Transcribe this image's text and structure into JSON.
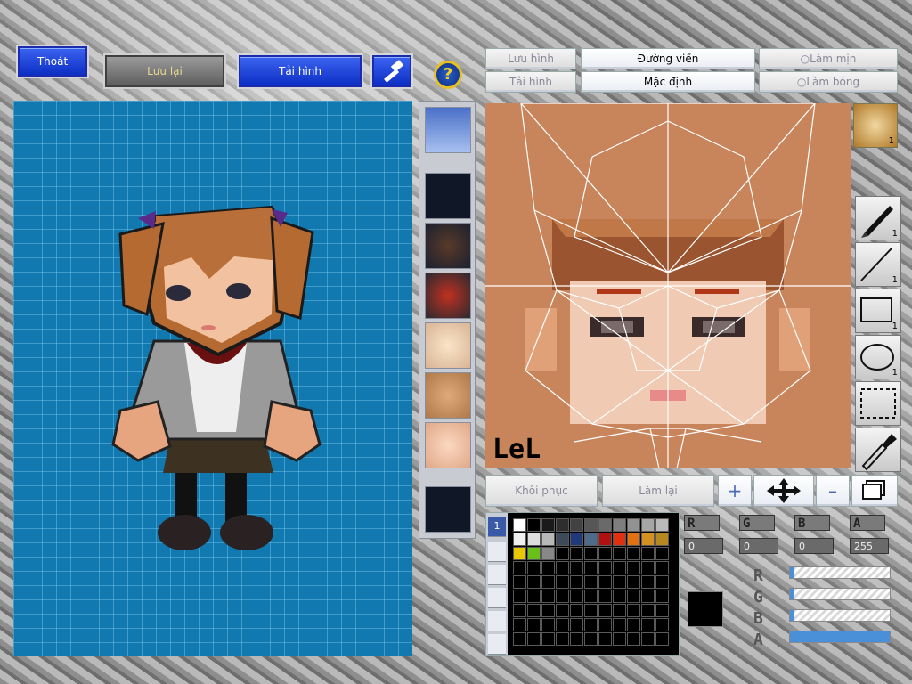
{
  "toolbar": {
    "exit_label": "Thoát",
    "save_label": "Lưu lại",
    "reload_label": "Tải hình",
    "help_symbol": "?",
    "hammer_icon": "hammer-icon"
  },
  "texture_toolbar": {
    "save_label": "Lưu hình",
    "load_label": "Tải hình",
    "outline_label": "Đường viền",
    "default_label": "Mặc định",
    "smooth_label": "Làm mịn",
    "shine_label": "Làm bóng"
  },
  "face_thumb_count": "1",
  "texture_signature": "LeL",
  "tools": [
    {
      "name": "brush",
      "icon": "brush-icon",
      "count": "1"
    },
    {
      "name": "line",
      "icon": "line-icon",
      "count": "1"
    },
    {
      "name": "rectangle",
      "icon": "rectangle-icon",
      "count": "1"
    },
    {
      "name": "ellipse",
      "icon": "ellipse-icon",
      "count": "1"
    },
    {
      "name": "selection",
      "icon": "selection-icon",
      "count": ""
    },
    {
      "name": "eyedropper",
      "icon": "eyedropper-icon",
      "count": ""
    }
  ],
  "edit_buttons": {
    "restore_label": "Khôi phục",
    "redo_label": "Làm lại",
    "zoom_in_symbol": "+",
    "zoom_out_symbol": "–"
  },
  "palette": {
    "tab_label": "1",
    "row1": [
      "#ffffff",
      "#000000",
      "#1a1a1a",
      "#2e2e2e",
      "#424242",
      "#565656",
      "#6a6a6a",
      "#7e7e7e",
      "#929292",
      "#a6a6a6",
      "#bababa"
    ],
    "row2": [
      "#f0f0f0",
      "#dddddd",
      "#b8b8b8",
      "#3d4a5a",
      "#1f3a7a",
      "#506a8a",
      "#b01010",
      "#e03010",
      "#e07010",
      "#d49020",
      "#b88820"
    ],
    "row3": [
      "#e8c800",
      "#68c018",
      "#888888"
    ]
  },
  "channels": {
    "r_label": "R",
    "r_value": "0",
    "g_label": "G",
    "g_value": "0",
    "b_label": "B",
    "b_value": "0",
    "a_label": "A",
    "a_value": "255"
  },
  "current_color": "#000000",
  "slider_levels": {
    "r": 0,
    "g": 0,
    "b": 0,
    "a": 1
  }
}
